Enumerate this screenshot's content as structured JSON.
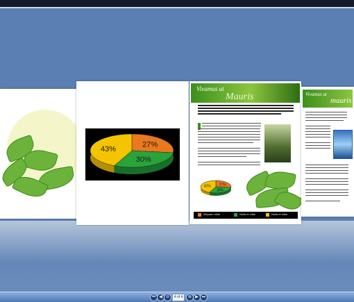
{
  "viewer": {
    "nav": {
      "page_indicator": "4 of 4",
      "buttons": [
        "first-icon",
        "prev-icon",
        "zoom-icon",
        "zoom-in-icon",
        "next-icon",
        "last-icon"
      ]
    }
  },
  "chart_data": {
    "type": "pie",
    "categories": [
      "orange",
      "green",
      "yellow"
    ],
    "values": [
      27,
      30,
      43
    ],
    "labels": [
      "27%",
      "30%",
      "43%"
    ],
    "colors": [
      "#e9781f",
      "#2aa33b",
      "#f5c400"
    ]
  },
  "brochure": {
    "title_script": "Vivamus ut",
    "title_large": "Mauris",
    "body_lead": "Lorem ipsum dolor sit amet, consectetur adipiscing elit. Proin blandit dui est eros",
    "footer_items": [
      "Aliquam vitae",
      "Nulla et vitae",
      "Nulla et vitae"
    ],
    "mini_pie_labels": [
      "27%",
      "30%",
      "43%"
    ]
  },
  "side_page": {
    "title_script": "Vivamus ut",
    "title_large": "mauris"
  },
  "colors": {
    "background": "#5b7fb2",
    "accent_green": "#6bb33a"
  }
}
